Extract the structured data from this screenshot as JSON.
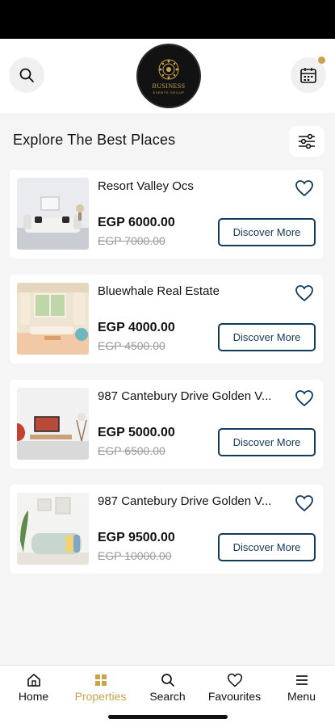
{
  "header": {
    "logo_text": "BUSINESS",
    "logo_subtext": "EVENTS GROUP",
    "icons": {
      "search": "search-icon",
      "calendar": "calendar-icon"
    },
    "accent_color": "#c9a24a"
  },
  "main": {
    "section_title": "Explore The Best Places",
    "filter_icon": "sliders-icon",
    "listings": [
      {
        "title": "Resort Valley Ocs",
        "price": "EGP 6000.00",
        "old_price": "EGP 7000.00",
        "cta": "Discover More"
      },
      {
        "title": "Bluewhale Real Estate",
        "price": "EGP 4000.00",
        "old_price": "EGP 4500.00",
        "cta": "Discover More"
      },
      {
        "title": "987 Cantebury Drive Golden V...",
        "price": "EGP 5000.00",
        "old_price": "EGP 6500.00",
        "cta": "Discover More"
      },
      {
        "title": "987 Cantebury Drive Golden V...",
        "price": "EGP 9500.00",
        "old_price": "EGP 10000.00",
        "cta": "Discover More"
      }
    ]
  },
  "bottom_nav": {
    "items": [
      {
        "label": "Home",
        "icon": "home-icon"
      },
      {
        "label": "Properties",
        "icon": "grid-icon",
        "active": true
      },
      {
        "label": "Search",
        "icon": "search-icon"
      },
      {
        "label": "Favourites",
        "icon": "heart-icon"
      },
      {
        "label": "Menu",
        "icon": "menu-icon"
      }
    ],
    "active_color": "#c9a24a"
  },
  "colors": {
    "brand_navy": "#123a5a",
    "strike_gray": "#9a9a9a"
  }
}
